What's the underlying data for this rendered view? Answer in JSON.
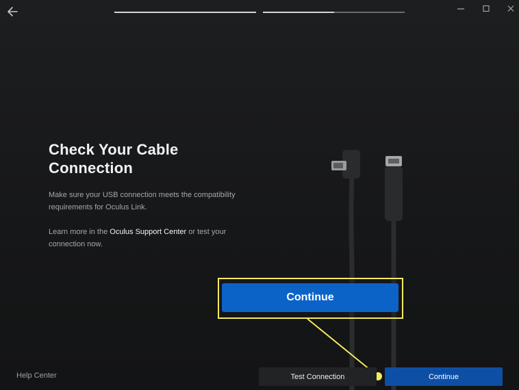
{
  "window": {
    "back_icon": "arrow-left-icon",
    "controls": {
      "minimize_icon": "minimize-icon",
      "maximize_icon": "maximize-icon",
      "close_icon": "close-icon"
    }
  },
  "progress": {
    "steps": [
      {
        "fraction": 1.0
      },
      {
        "fraction": 0.5
      }
    ]
  },
  "content": {
    "title": "Check Your Cable Connection",
    "paragraph1": "Make sure your USB connection meets the compatibility requirements for Oculus Link.",
    "paragraph2_before": "Learn more in the ",
    "paragraph2_link": "Oculus Support Center",
    "paragraph2_after": " or test your connection now.",
    "illustration": "usb-c-cable-illustration"
  },
  "callout": {
    "button_label": "Continue",
    "highlight_color": "#f4ec5f"
  },
  "footer": {
    "help_label": "Help Center",
    "test_label": "Test Connection",
    "continue_label": "Continue"
  },
  "colors": {
    "accent": "#0b63c8",
    "primary_button": "#0d4fa5",
    "background": "#18191a"
  }
}
